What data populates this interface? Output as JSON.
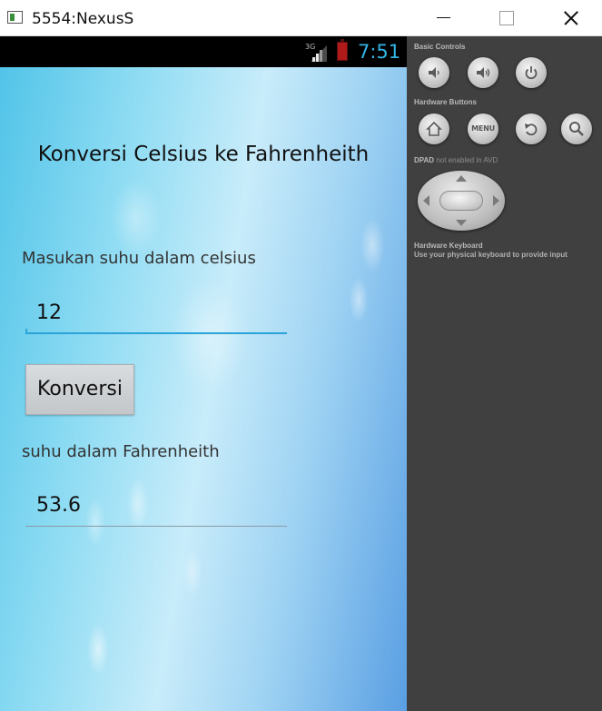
{
  "window": {
    "title": "5554:NexusS"
  },
  "statusbar": {
    "network": "3G",
    "time": "7:51"
  },
  "app": {
    "heading": "Konversi Celsius ke Fahrenheith",
    "celsius_label": "Masukan suhu dalam celsius",
    "celsius_value": "12",
    "convert_button": "Konversi",
    "fahrenheit_label": "suhu dalam Fahrenheith",
    "fahrenheit_value": "53.6"
  },
  "controls": {
    "basic_title": "Basic Controls",
    "hardware_title": "Hardware Buttons",
    "menu_label": "MENU",
    "dpad_title": "DPAD",
    "dpad_note": "not enabled in AVD",
    "keyboard_title": "Hardware Keyboard",
    "keyboard_note": "Use your physical keyboard to provide input"
  },
  "colors": {
    "accent": "#33b5e5",
    "panel": "#404040",
    "battery": "#b01a1a"
  },
  "icons": [
    "volume-down-icon",
    "volume-up-icon",
    "power-icon",
    "home-icon",
    "back-icon",
    "search-icon",
    "signal-icon",
    "battery-icon"
  ]
}
